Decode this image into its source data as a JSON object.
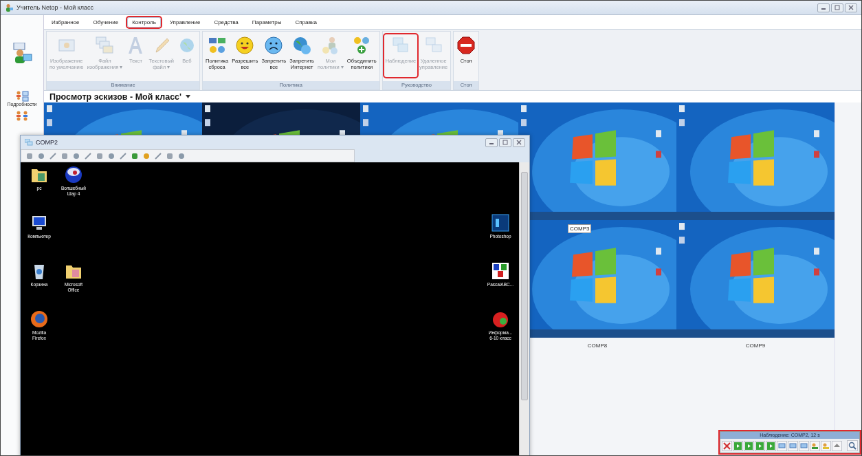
{
  "window": {
    "title": "Учитель Netop - Мой класс"
  },
  "tabs": [
    {
      "label": "Избранное",
      "selected": false,
      "highlighted": false
    },
    {
      "label": "Обучение",
      "selected": false,
      "highlighted": false
    },
    {
      "label": "Контроль",
      "selected": true,
      "highlighted": true
    },
    {
      "label": "Управление",
      "selected": false,
      "highlighted": false
    },
    {
      "label": "Средства",
      "selected": false,
      "highlighted": false
    },
    {
      "label": "Параметры",
      "selected": false,
      "highlighted": false
    },
    {
      "label": "Справка",
      "selected": false,
      "highlighted": false
    }
  ],
  "ribbon_groups": [
    {
      "label": "Внимание",
      "buttons": [
        {
          "lines": [
            "Изображение",
            "по умолчанию"
          ],
          "disabled": true,
          "highlighted": false
        },
        {
          "lines": [
            "Файл",
            "изображения ▾"
          ],
          "disabled": true,
          "highlighted": false
        },
        {
          "lines": [
            "Текст"
          ],
          "disabled": true,
          "highlighted": false
        },
        {
          "lines": [
            "Текстовый",
            "файл ▾"
          ],
          "disabled": true,
          "highlighted": false
        },
        {
          "lines": [
            "Веб"
          ],
          "disabled": true,
          "highlighted": false
        }
      ]
    },
    {
      "label": "Политика",
      "buttons": [
        {
          "lines": [
            "Политика",
            "сброса"
          ],
          "disabled": false,
          "highlighted": false
        },
        {
          "lines": [
            "Разрешить",
            "все"
          ],
          "disabled": false,
          "highlighted": false
        },
        {
          "lines": [
            "Запретить",
            "все"
          ],
          "disabled": false,
          "highlighted": false
        },
        {
          "lines": [
            "Запретить",
            "Интернет"
          ],
          "disabled": false,
          "highlighted": false
        },
        {
          "lines": [
            "Мои",
            "политики ▾"
          ],
          "disabled": true,
          "highlighted": false
        },
        {
          "lines": [
            "Объединить",
            "политики"
          ],
          "disabled": false,
          "highlighted": false
        }
      ]
    },
    {
      "label": "Руководство",
      "buttons": [
        {
          "lines": [
            "Наблюдение"
          ],
          "disabled": true,
          "highlighted": true
        },
        {
          "lines": [
            "Удаленное",
            "управление"
          ],
          "disabled": true,
          "highlighted": false
        }
      ]
    },
    {
      "label": "Стоп",
      "buttons": [
        {
          "lines": [
            "Стоп"
          ],
          "disabled": false,
          "highlighted": false
        }
      ]
    }
  ],
  "sidebar": {
    "items": [
      {
        "label": "Подробности"
      }
    ]
  },
  "view_title": "Просмотр эскизов - Мой класс'",
  "thumbnail_rows": [
    [
      {
        "kind": "picture"
      },
      {
        "kind": "picture"
      },
      {
        "kind": "picture"
      },
      {
        "kind": "picture"
      },
      {
        "kind": "picture"
      }
    ],
    [
      {
        "kind": "hidden"
      },
      {
        "kind": "hidden"
      },
      {
        "kind": "hidden"
      },
      {
        "kind": "picture",
        "tag": "COMP3",
        "caption": "COMP8"
      },
      {
        "kind": "picture",
        "caption": "COMP9"
      }
    ]
  ],
  "remote_window": {
    "title": "COMP2",
    "desktop_left": [
      [
        "pc",
        "Волшебный\nШар 4"
      ],
      [
        "Компьютер"
      ],
      [
        "Корзина",
        "Microsoft\nOffice"
      ],
      [
        "Mozilla\nFirefox"
      ]
    ],
    "desktop_right": [
      "Photoshop",
      "PascalABC...",
      "Информа...\n6-10 класс"
    ]
  },
  "observe_panel": {
    "title": "Наблюдение: COMP2, 12 s",
    "highlighted": true
  }
}
